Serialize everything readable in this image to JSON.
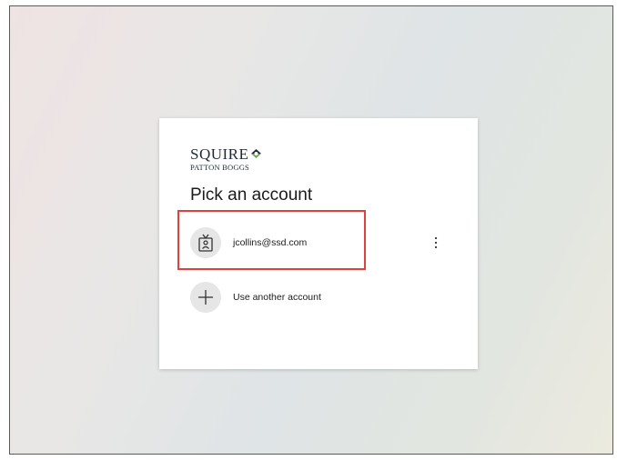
{
  "brand": {
    "line1": "SQUIRE",
    "line2": "PATTON BOGGS"
  },
  "title": "Pick an account",
  "accounts": [
    {
      "email": "jcollins@ssd.com",
      "avatar_icon": "badge-person-icon",
      "more_icon": "more-vertical-icon"
    }
  ],
  "other_account": {
    "label": "Use another account",
    "icon": "plus-icon"
  },
  "highlight_color": "#e0413d"
}
